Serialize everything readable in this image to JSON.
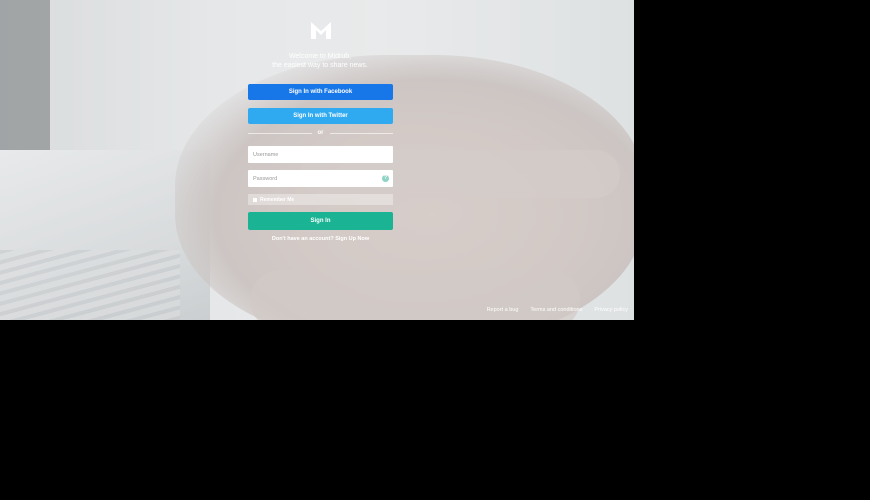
{
  "welcome": {
    "line1": "Welcome to Midrub,",
    "line2": "the easiest way to share news."
  },
  "social": {
    "facebook_label": "Sign In with Facebook",
    "twitter_label": "Sign In with Twitter"
  },
  "divider": {
    "or_label": "or"
  },
  "form": {
    "username_placeholder": "Username",
    "password_placeholder": "Password",
    "help_icon": "?",
    "remember_label": "Remember Me",
    "signin_label": "Sign In"
  },
  "signup": {
    "text": "Don't have an account? Sign Up Now"
  },
  "footer": {
    "links": [
      "Report a bug",
      "Terms and conditions",
      "Privacy policy"
    ]
  },
  "colors": {
    "facebook": "#1877e8",
    "twitter": "#2fa9f0",
    "signin": "#1ab394"
  }
}
